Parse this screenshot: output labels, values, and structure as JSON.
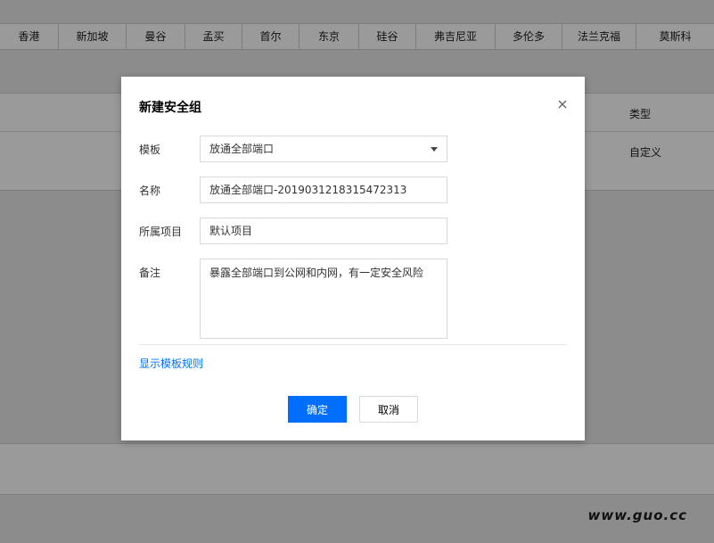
{
  "background": {
    "regions": [
      "香港",
      "新加坡",
      "曼谷",
      "孟买",
      "首尔",
      "东京",
      "硅谷",
      "弗吉尼亚",
      "多伦多",
      "法兰克福",
      "莫斯科"
    ],
    "table_header_type": "类型",
    "table_row_type": "自定义"
  },
  "dialog": {
    "title": "新建安全组",
    "template_label": "模板",
    "template_value": "放通全部端口",
    "name_label": "名称",
    "name_value": "放通全部端口-2019031218315472313",
    "project_label": "所属项目",
    "project_value": "默认项目",
    "remark_label": "备注",
    "remark_value": "暴露全部端口到公网和内网，有一定安全风险",
    "show_rules_link": "显示模板规则",
    "confirm_button": "确定",
    "cancel_button": "取消"
  },
  "watermark": "www.guo.cc",
  "colors": {
    "primary": "#006eff",
    "overlay": "#8c8c8c"
  },
  "icons": {
    "close": "close-icon",
    "select_arrow": "caret-down-icon"
  }
}
